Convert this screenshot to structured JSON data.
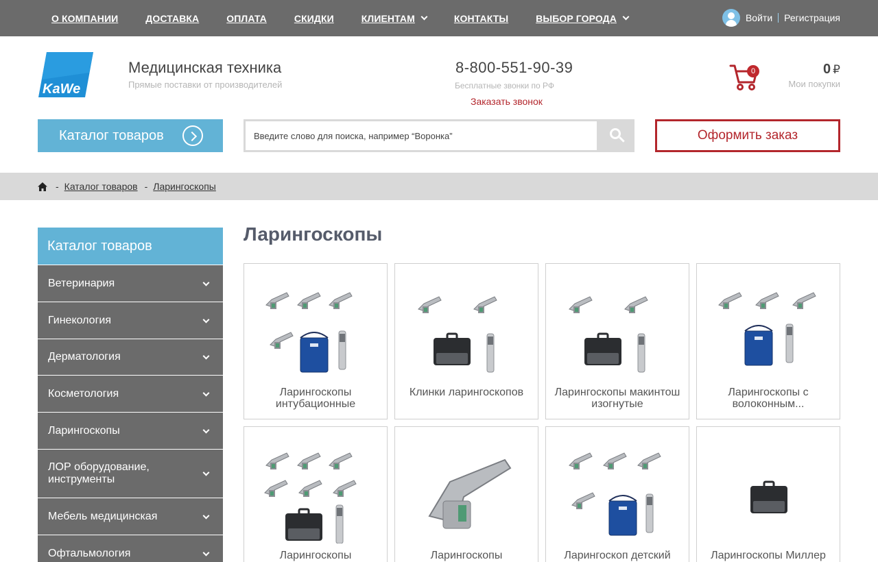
{
  "topnav": {
    "items": [
      {
        "label": "О КОМПАНИИ",
        "dropdown": false
      },
      {
        "label": "ДОСТАВКА",
        "dropdown": false
      },
      {
        "label": "ОПЛАТА",
        "dropdown": false
      },
      {
        "label": "СКИДКИ",
        "dropdown": false
      },
      {
        "label": "КЛИЕНТАМ",
        "dropdown": true
      },
      {
        "label": "КОНТАКТЫ",
        "dropdown": false
      },
      {
        "label": "ВЫБОР ГОРОДА",
        "dropdown": true
      }
    ],
    "login": "Войти",
    "register": "Регистрация"
  },
  "header": {
    "logo_text": "KaWe",
    "title": "Медицинская техника",
    "subtitle": "Прямые поставки от производителей",
    "phone": "8-800-551-90-39",
    "phone_note": "Бесплатные звонки по РФ",
    "callback": "Заказать звонок",
    "cart_count": "0",
    "cart_sum": "0",
    "currency": "₽",
    "cart_label": "Мои покупки"
  },
  "toolbar": {
    "catalog_label": "Каталог товаров",
    "search_placeholder": "Введите слово для поиска, например “Воронка”",
    "order_label": "Оформить заказ"
  },
  "breadcrumb": {
    "items": [
      "Каталог товаров",
      "Ларингоскопы"
    ]
  },
  "sidebar": {
    "title": "Каталог товаров",
    "items": [
      {
        "label": "Ветеринария"
      },
      {
        "label": "Гинекология"
      },
      {
        "label": "Дерматология"
      },
      {
        "label": "Косметология"
      },
      {
        "label": "Ларингоскопы"
      },
      {
        "label": "ЛОР оборудование, инструменты"
      },
      {
        "label": "Мебель медицинская"
      },
      {
        "label": "Офтальмология"
      }
    ]
  },
  "main": {
    "title": "Ларингоскопы",
    "products": [
      {
        "name": "Ларингоскопы интубационные"
      },
      {
        "name": "Клинки ларингоскопов"
      },
      {
        "name": "Ларингоскопы макинтош изогнутые"
      },
      {
        "name": "Ларингоскопы с волоконным..."
      },
      {
        "name": "Ларингоскопы"
      },
      {
        "name": "Ларингоскопы"
      },
      {
        "name": "Ларингоскоп детский"
      },
      {
        "name": "Ларингоскопы Миллер"
      }
    ]
  },
  "colors": {
    "topbar": "#6b6b6b",
    "accent_blue": "#62b3d6",
    "accent_red": "#b3262c",
    "breadcrumb_bg": "#d9d9d9"
  }
}
